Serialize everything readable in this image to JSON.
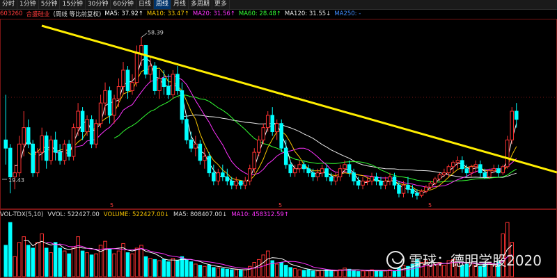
{
  "toolbar": {
    "tabs": [
      "分时",
      "1分钟",
      "5分钟",
      "15分钟",
      "30分钟",
      "60分钟",
      "日线",
      "周线",
      "月线",
      "多周期",
      "更多"
    ],
    "active_index": 7,
    "more_arrow": "›"
  },
  "info": {
    "code": "603260",
    "name": "合盛硅业",
    "adjust": "(周线 等比前复权)",
    "ma": [
      {
        "label": "MA5: 37.92↑",
        "color": "#ffffff"
      },
      {
        "label": "MA10: 33.47↑",
        "color": "#f5c400"
      },
      {
        "label": "MA20: 31.56↑",
        "color": "#ff33ff"
      },
      {
        "label": "MA60: 28.48↑",
        "color": "#33ff33"
      },
      {
        "label": "MA120: 31.55↓",
        "color": "#e8e8e8"
      },
      {
        "label": "MA250: -",
        "color": "#3f8cff"
      }
    ]
  },
  "price_annotations": {
    "high": "58.39",
    "low": "19.43"
  },
  "vol_info": {
    "items": [
      {
        "label": "VOL-TDX(5,10)",
        "color": "#dddddd"
      },
      {
        "label": "VVOL: 522427.00",
        "color": "#dddddd"
      },
      {
        "label": "VOLUME: 522427.00↓",
        "color": "#f5c400"
      },
      {
        "label": "MA5: 808407.00↓",
        "color": "#dddddd"
      },
      {
        "label": "MA10: 458312.59↑",
        "color": "#ff33ff"
      }
    ]
  },
  "watermark": {
    "text": "雪球：德明学股2020"
  },
  "colors": {
    "up": "#ff3232",
    "down": "#00ffff",
    "trendline": "#ffee00",
    "grid": "#7a1515",
    "ma5": "#ffffff",
    "ma10": "#f5c400",
    "ma20": "#ff33ff",
    "ma60": "#33ff33",
    "ma120": "#e8e8e8"
  },
  "chart_data": {
    "type": "candlestick",
    "y_range": [
      18,
      62
    ],
    "candles": [
      [
        33,
        44,
        27,
        31
      ],
      [
        31,
        32,
        20,
        24
      ],
      [
        24,
        27,
        21,
        25
      ],
      [
        25,
        34,
        24,
        32
      ],
      [
        32,
        40,
        29,
        36
      ],
      [
        36,
        38,
        31,
        32
      ],
      [
        32,
        33,
        24,
        25
      ],
      [
        25,
        31,
        24,
        30
      ],
      [
        30,
        36,
        28,
        34
      ],
      [
        34,
        35,
        26,
        28
      ],
      [
        28,
        34,
        27,
        33
      ],
      [
        33,
        35,
        28,
        30
      ],
      [
        30,
        32,
        27,
        28
      ],
      [
        28,
        33,
        27,
        32
      ],
      [
        32,
        33,
        28,
        29
      ],
      [
        29,
        37,
        28,
        36
      ],
      [
        36,
        42,
        34,
        40
      ],
      [
        40,
        41,
        33,
        35
      ],
      [
        35,
        39,
        34,
        38
      ],
      [
        38,
        39,
        31,
        32
      ],
      [
        32,
        38,
        31,
        37
      ],
      [
        37,
        44,
        36,
        42
      ],
      [
        42,
        47,
        39,
        45
      ],
      [
        45,
        46,
        37,
        39
      ],
      [
        39,
        44,
        37,
        43
      ],
      [
        43,
        48,
        41,
        46
      ],
      [
        46,
        52,
        44,
        50
      ],
      [
        50,
        51,
        43,
        45
      ],
      [
        45,
        49,
        44,
        47
      ],
      [
        47,
        56,
        46,
        54
      ],
      [
        54,
        58,
        51,
        56
      ],
      [
        56,
        56,
        48,
        49
      ],
      [
        49,
        53,
        47,
        51
      ],
      [
        51,
        52,
        44,
        45
      ],
      [
        45,
        50,
        43,
        48
      ],
      [
        48,
        50,
        44,
        46
      ],
      [
        46,
        49,
        43,
        44
      ],
      [
        44,
        50,
        43,
        49
      ],
      [
        49,
        51,
        44,
        45
      ],
      [
        45,
        47,
        37,
        38
      ],
      [
        38,
        39,
        32,
        33
      ],
      [
        33,
        35,
        30,
        31
      ],
      [
        31,
        34,
        29,
        32
      ],
      [
        32,
        33,
        27,
        28
      ],
      [
        28,
        31,
        26,
        29
      ],
      [
        29,
        30,
        24,
        25
      ],
      [
        25,
        27,
        22,
        23
      ],
      [
        23,
        26,
        22,
        25
      ],
      [
        25,
        27,
        23,
        24
      ],
      [
        24,
        26,
        22,
        23
      ],
      [
        23,
        24,
        21,
        22
      ],
      [
        22,
        24,
        21,
        23
      ],
      [
        23,
        23,
        21,
        22
      ],
      [
        22,
        24,
        21,
        23
      ],
      [
        23,
        27,
        22,
        26
      ],
      [
        26,
        31,
        25,
        30
      ],
      [
        30,
        34,
        29,
        33
      ],
      [
        33,
        37,
        32,
        36
      ],
      [
        36,
        40,
        35,
        39
      ],
      [
        39,
        41,
        34,
        35
      ],
      [
        35,
        38,
        33,
        37
      ],
      [
        37,
        38,
        30,
        31
      ],
      [
        31,
        33,
        26,
        27
      ],
      [
        27,
        28,
        24,
        25
      ],
      [
        25,
        27,
        24,
        26
      ],
      [
        26,
        28,
        25,
        27
      ],
      [
        27,
        28,
        25,
        26
      ],
      [
        26,
        27,
        24,
        25
      ],
      [
        25,
        26,
        23,
        24
      ],
      [
        24,
        26,
        23,
        25
      ],
      [
        25,
        27,
        24,
        26
      ],
      [
        26,
        27,
        23,
        24
      ],
      [
        24,
        25,
        22,
        23
      ],
      [
        23,
        25,
        22,
        24
      ],
      [
        24,
        27,
        23,
        26
      ],
      [
        26,
        28,
        25,
        27
      ],
      [
        27,
        28,
        24,
        25
      ],
      [
        25,
        26,
        22,
        23
      ],
      [
        23,
        24,
        21,
        22
      ],
      [
        22,
        24,
        21,
        23
      ],
      [
        23,
        24,
        22,
        23
      ],
      [
        23,
        25,
        22,
        24
      ],
      [
        24,
        25,
        22,
        23
      ],
      [
        23,
        24,
        21,
        22
      ],
      [
        22,
        24,
        21,
        23
      ],
      [
        23,
        25,
        22,
        24
      ],
      [
        24,
        25,
        21,
        22
      ],
      [
        22,
        23,
        19,
        20
      ],
      [
        20,
        23,
        19,
        22
      ],
      [
        22,
        24,
        20,
        21
      ],
      [
        21,
        22,
        19,
        20
      ],
      [
        20,
        21,
        18.5,
        19.5
      ],
      [
        19.5,
        21,
        19,
        20.5
      ],
      [
        20.5,
        22,
        20,
        21.5
      ],
      [
        21.5,
        23,
        21,
        22.5
      ],
      [
        22.5,
        24,
        22,
        23.5
      ],
      [
        23.5,
        25,
        23,
        24.5
      ],
      [
        24.5,
        26,
        24,
        25
      ],
      [
        25,
        27,
        24,
        26.5
      ],
      [
        26.5,
        28,
        25,
        27.5
      ],
      [
        27.5,
        29,
        26,
        28
      ],
      [
        28,
        29,
        25,
        26
      ],
      [
        26,
        27,
        24,
        25
      ],
      [
        25,
        27,
        24,
        26.5
      ],
      [
        26.5,
        28,
        25,
        27
      ],
      [
        27,
        28,
        24,
        25
      ],
      [
        25,
        26,
        23.5,
        24
      ],
      [
        24,
        26,
        23.5,
        25.5
      ],
      [
        25.5,
        27,
        25,
        26
      ],
      [
        26,
        27,
        24,
        25
      ],
      [
        25,
        27,
        24.5,
        26.5
      ],
      [
        26.5,
        34,
        26,
        33
      ],
      [
        33,
        41,
        32,
        40
      ],
      [
        40,
        42,
        36,
        38
      ]
    ],
    "volumes": [
      0.55,
      0.95,
      0.35,
      0.6,
      0.7,
      0.55,
      0.5,
      0.6,
      0.75,
      0.5,
      0.42,
      0.6,
      0.5,
      0.45,
      0.4,
      0.52,
      0.7,
      0.45,
      0.42,
      0.38,
      0.4,
      0.55,
      0.62,
      0.48,
      0.4,
      0.45,
      0.58,
      0.42,
      0.4,
      0.5,
      0.55,
      0.35,
      0.32,
      0.3,
      0.28,
      0.3,
      0.26,
      0.32,
      0.28,
      0.35,
      0.3,
      0.26,
      0.22,
      0.2,
      0.18,
      0.2,
      0.16,
      0.15,
      0.14,
      0.13,
      0.12,
      0.12,
      0.11,
      0.12,
      0.18,
      0.25,
      0.3,
      0.38,
      0.45,
      0.28,
      0.22,
      0.25,
      0.2,
      0.16,
      0.14,
      0.12,
      0.11,
      0.12,
      0.1,
      0.1,
      0.11,
      0.12,
      0.1,
      0.1,
      0.12,
      0.15,
      0.13,
      0.1,
      0.09,
      0.1,
      0.1,
      0.12,
      0.1,
      0.09,
      0.1,
      0.12,
      0.1,
      0.15,
      0.2,
      0.18,
      0.22,
      0.3,
      0.25,
      0.28,
      0.2,
      0.22,
      0.25,
      0.2,
      0.28,
      0.3,
      0.25,
      0.2,
      0.22,
      0.24,
      0.2,
      0.18,
      0.22,
      0.24,
      0.2,
      0.26,
      0.75,
      0.95,
      0.6
    ],
    "trendline": {
      "from_index": 0,
      "from_price": 58.0,
      "to_index": 112,
      "to_price": 25.5
    }
  }
}
